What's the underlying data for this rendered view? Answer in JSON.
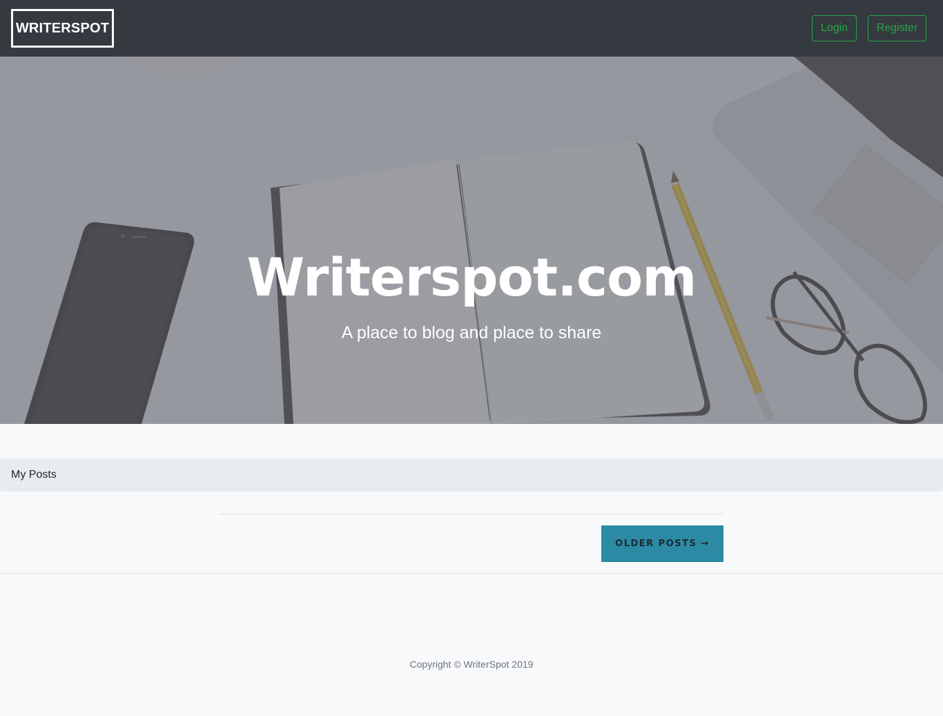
{
  "navbar": {
    "brand": "WRITERSPOT",
    "login_label": "Login",
    "register_label": "Register"
  },
  "hero": {
    "title": "Writerspot.com",
    "subtitle": "A place to blog and place to share"
  },
  "posts": {
    "section_label": "My Posts",
    "older_posts_label": "OLDER POSTS →"
  },
  "footer": {
    "copyright": "Copyright © WriterSpot 2019"
  },
  "colors": {
    "navbar_bg": "#343a40",
    "accent_green": "#28a745",
    "older_button_bg": "#2c8aa4",
    "page_bg": "#f8f9fa"
  }
}
